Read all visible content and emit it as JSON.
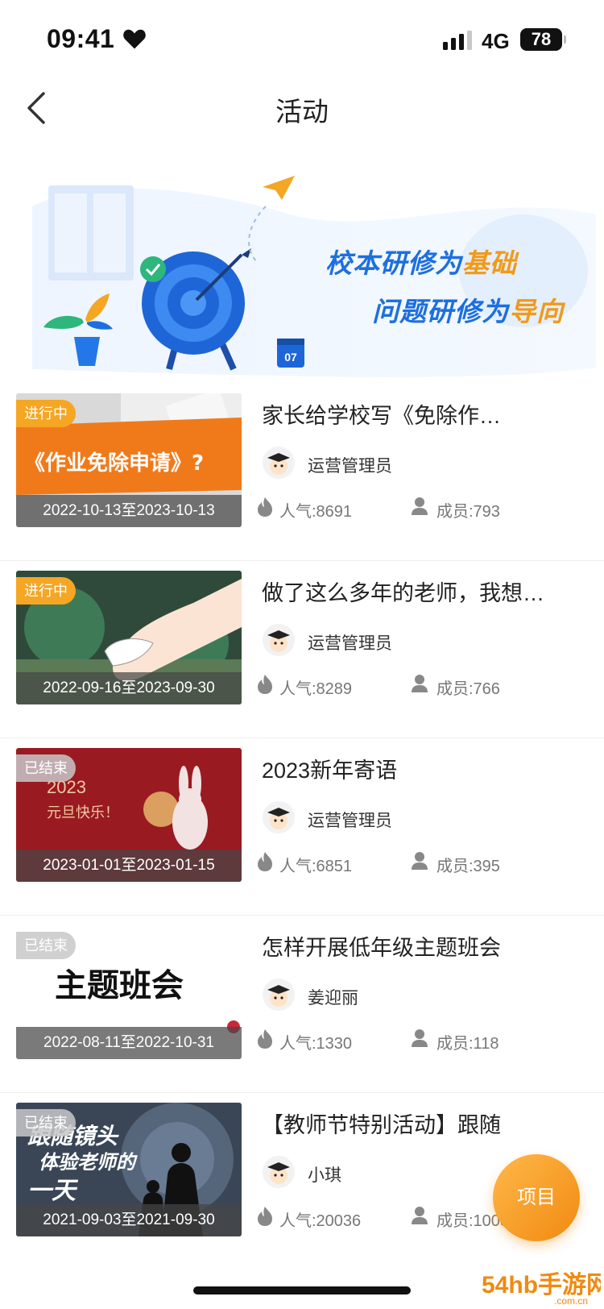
{
  "status_bar": {
    "time": "09:41",
    "network": "4G",
    "battery": "78"
  },
  "nav": {
    "title": "活动"
  },
  "banner": {
    "line1_main": "校本研修为",
    "line1_hl": "基础",
    "line2_main": "问题研修为",
    "line2_hl": "导向",
    "calendar_day": "07"
  },
  "activities": [
    {
      "title": "家长给学校写《免除作…",
      "status": "进行中",
      "dates": "2022-10-13至2023-10-13",
      "author": "运营管理员",
      "popularity": "人气:8691",
      "members": "成员:793",
      "thumb_text": "《作业免除申请》?"
    },
    {
      "title": "做了这么多年的老师，我想…",
      "status": "进行中",
      "dates": "2022-09-16至2023-09-30",
      "author": "运营管理员",
      "popularity": "人气:8289",
      "members": "成员:766"
    },
    {
      "title": "2023新年寄语",
      "status": "已结束",
      "dates": "2023-01-01至2023-01-15",
      "author": "运营管理员",
      "popularity": "人气:6851",
      "members": "成员:395",
      "thumb_text": "2023",
      "thumb_text2": "元旦快乐！"
    },
    {
      "title": "怎样开展低年级主题班会",
      "status": "已结束",
      "dates": "2022-08-11至2022-10-31",
      "author": "姜迎丽",
      "popularity": "人气:1330",
      "members": "成员:118",
      "thumb_text": "主题班会"
    },
    {
      "title": "【教师节特别活动】跟随",
      "status": "已结束",
      "dates": "2021-09-03至2021-09-30",
      "author": "小琪",
      "popularity": "人气:20036",
      "members": "成员:1003",
      "thumb_text": "跟随镜头",
      "thumb_text2": "体验老师的",
      "thumb_text3": "一天"
    }
  ],
  "fab": {
    "label": "项目"
  },
  "watermark": {
    "text": "54hb手游网",
    "sub": ".com.cn"
  },
  "colors": {
    "accent": "#f5a623",
    "banner_blue": "#1d6fe0"
  }
}
